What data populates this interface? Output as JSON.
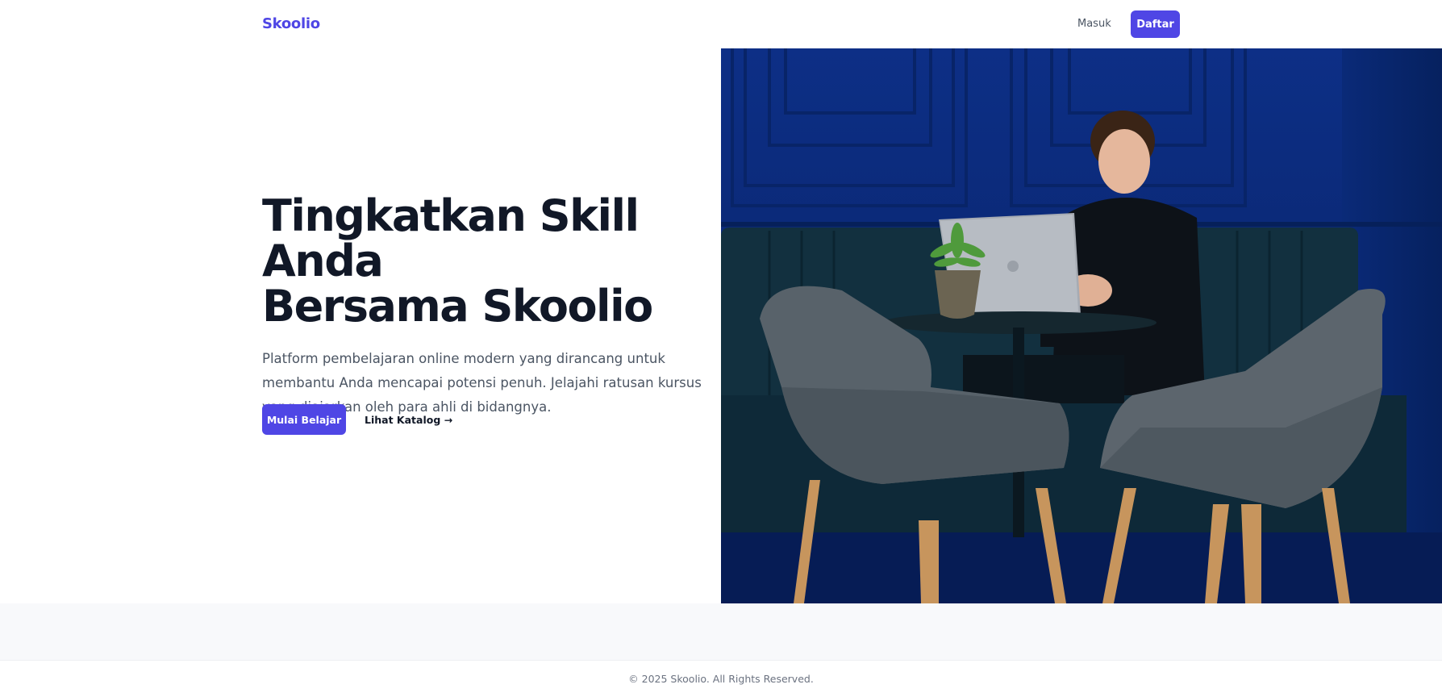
{
  "header": {
    "logo": "Skoolio",
    "login_label": "Masuk",
    "signup_label": "Daftar"
  },
  "hero": {
    "title_line1": "Tingkatkan Skill Anda",
    "title_line2": "Bersama Skoolio",
    "description": "Platform pembelajaran online modern yang dirancang untuk membantu Anda mencapai potensi penuh. Jelajahi ratusan kursus yang diajarkan oleh para ahli di bidangnya.",
    "primary_cta": "Mulai Belajar",
    "secondary_cta": "Lihat Katalog →"
  },
  "footer": {
    "copyright": "© 2025 Skoolio. All Rights Reserved."
  },
  "colors": {
    "brand": "#4f46e5",
    "heading": "#111827",
    "body_text": "#4b5563",
    "wall_blue": "#0b2a7a"
  }
}
